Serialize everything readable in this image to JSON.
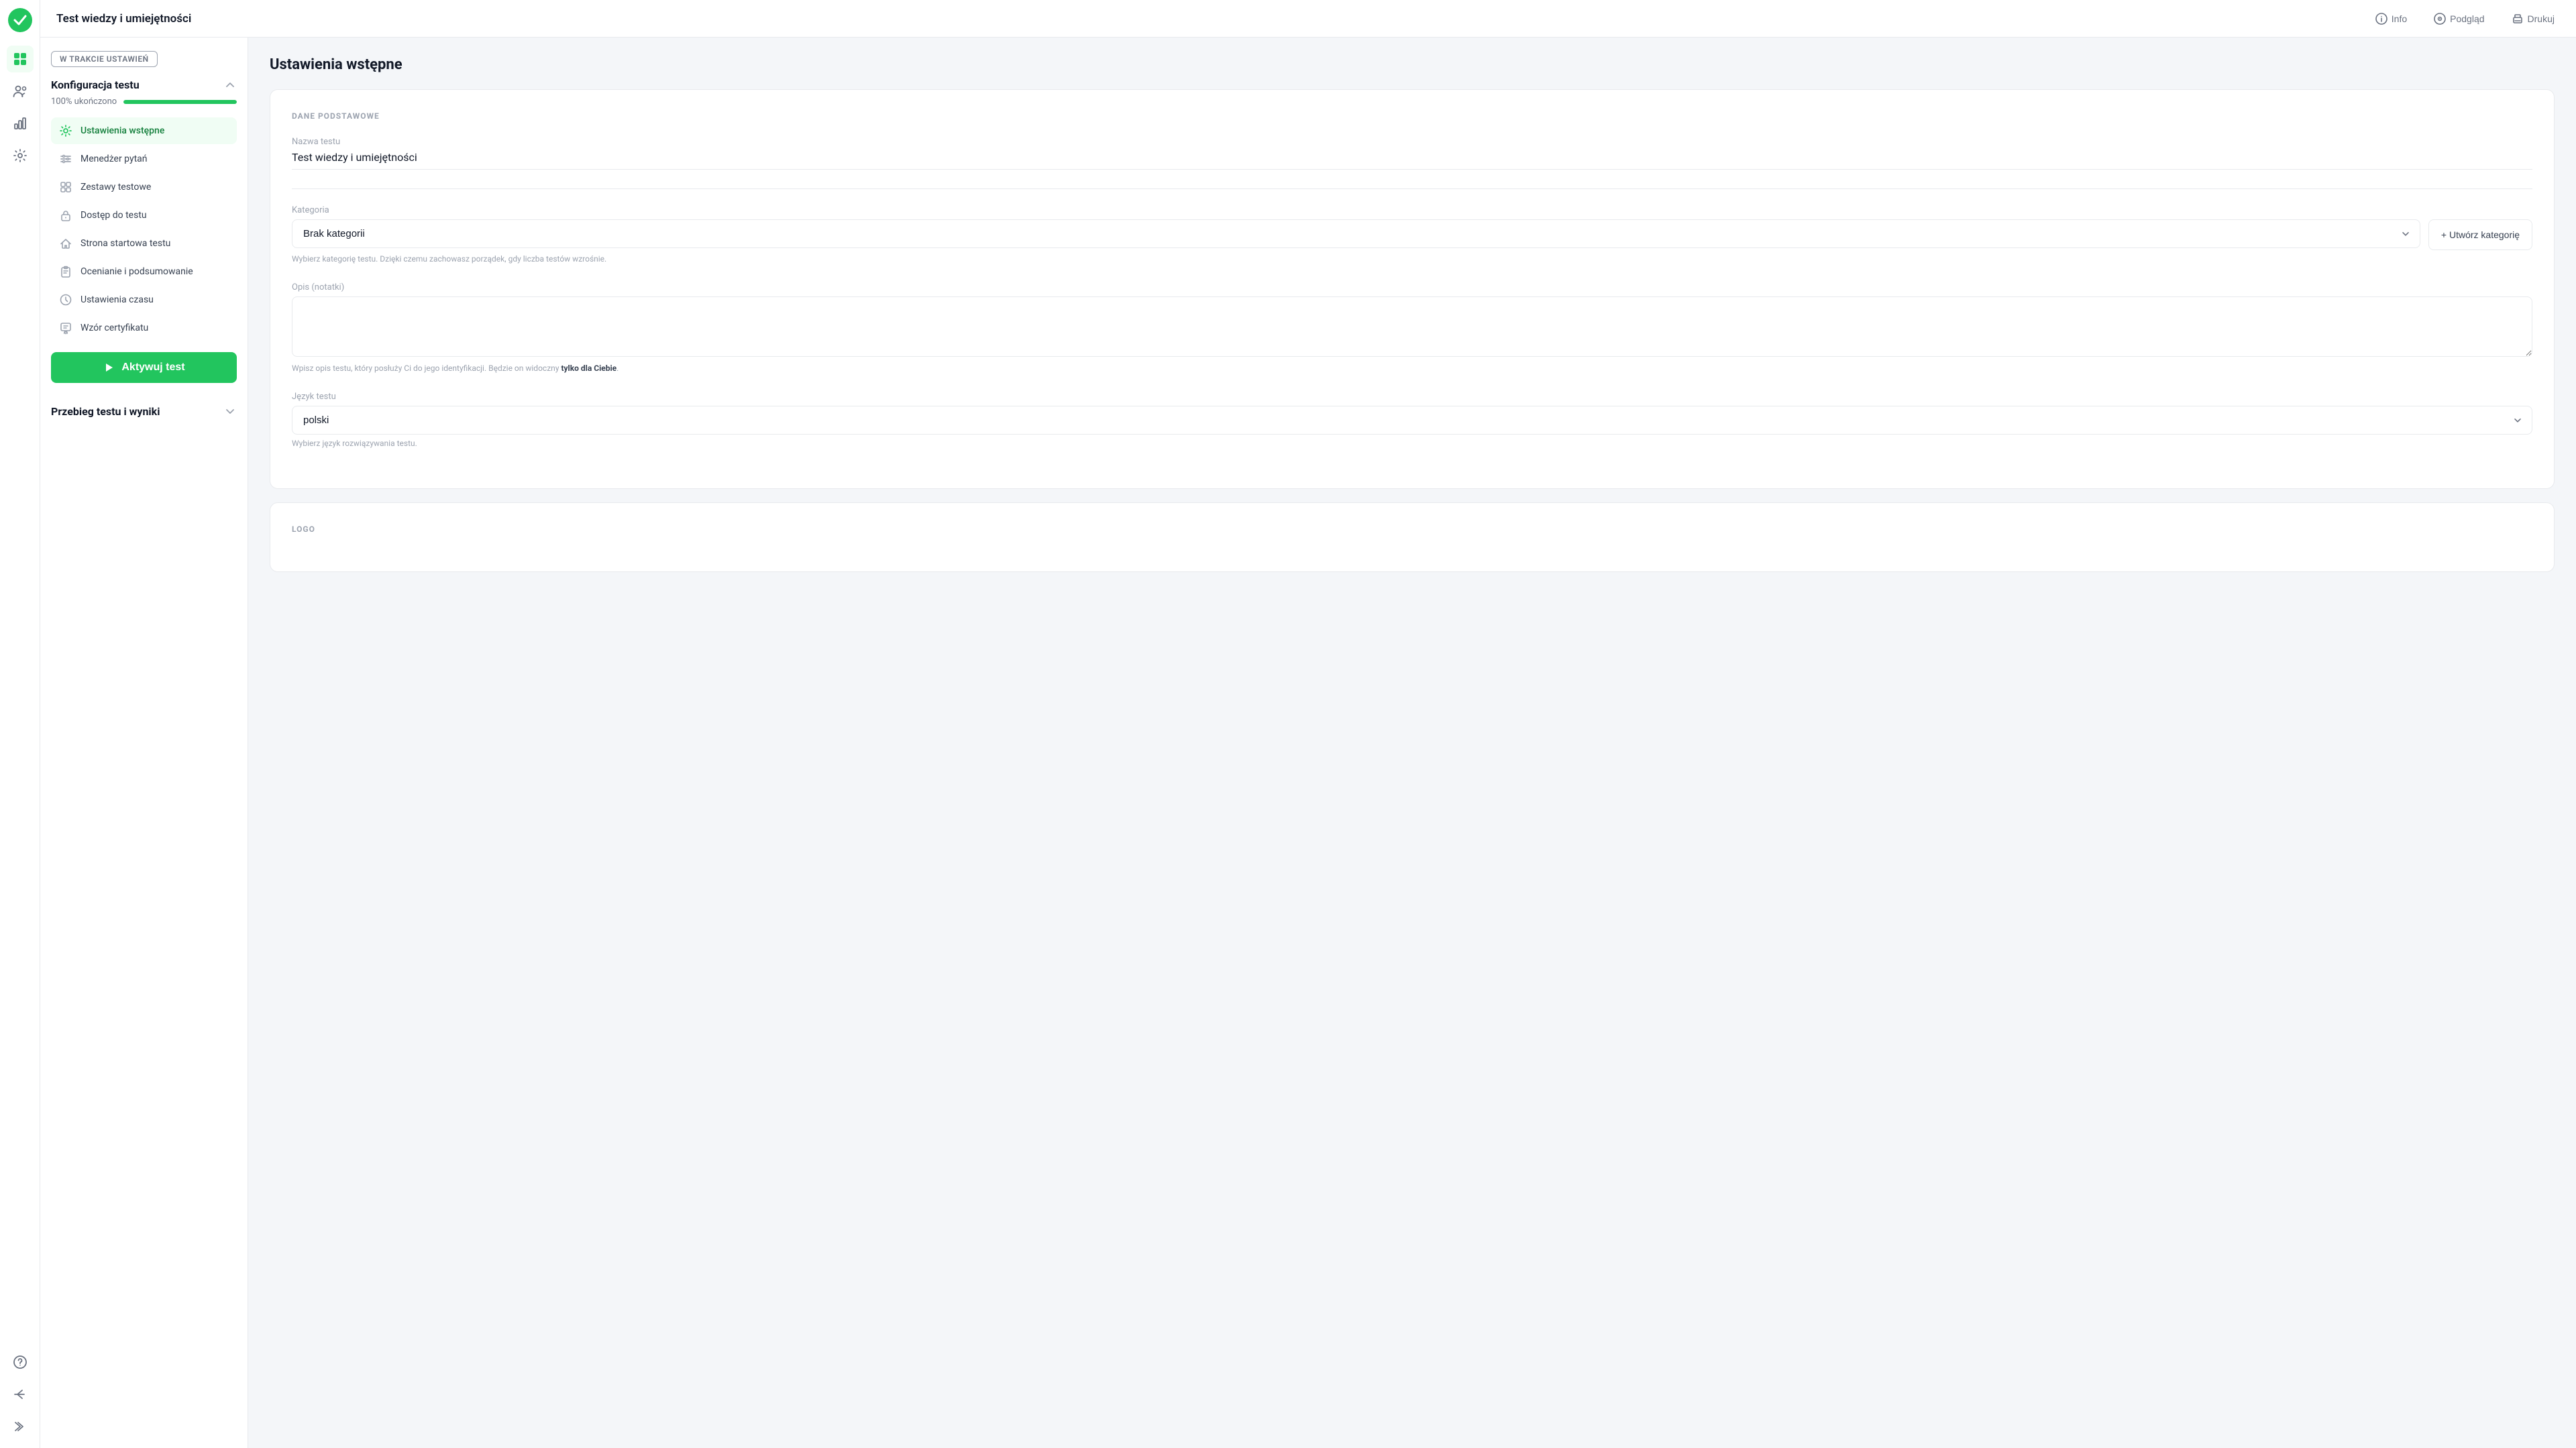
{
  "app": {
    "title": "Test wiedzy i umiejętności"
  },
  "header": {
    "title": "Test wiedzy i umiejętności",
    "actions": [
      {
        "id": "info",
        "label": "Info",
        "icon": "info-icon"
      },
      {
        "id": "preview",
        "label": "Podgląd",
        "icon": "eye-icon"
      },
      {
        "id": "print",
        "label": "Drukuj",
        "icon": "print-icon"
      }
    ]
  },
  "sidebar": {
    "status_badge": "W TRAKCIE USTAWIEŃ",
    "section1_title": "Konfiguracja testu",
    "progress_label": "100% ukończono",
    "progress_pct": 100,
    "nav_items": [
      {
        "id": "ustawienia-wstepne",
        "label": "Ustawienia wstępne",
        "active": true
      },
      {
        "id": "menedzer-pytan",
        "label": "Menedżer pytań",
        "active": false
      },
      {
        "id": "zestawy-testowe",
        "label": "Zestawy testowe",
        "active": false
      },
      {
        "id": "dostep-do-testu",
        "label": "Dostęp do testu",
        "active": false
      },
      {
        "id": "strona-startowa-testu",
        "label": "Strona startowa testu",
        "active": false
      },
      {
        "id": "ocenianie-i-podsumowanie",
        "label": "Ocenianie i podsumowanie",
        "active": false
      },
      {
        "id": "ustawienia-czasu",
        "label": "Ustawienia czasu",
        "active": false
      },
      {
        "id": "wzor-certyfikatu",
        "label": "Wzór certyfikatu",
        "active": false
      }
    ],
    "activate_btn_label": "Aktywuj test",
    "section2_title": "Przebieg testu i wyniki"
  },
  "main": {
    "page_title": "Ustawienia wstępne",
    "section_label": "DANE PODSTAWOWE",
    "fields": {
      "nazwa_label": "Nazwa testu",
      "nazwa_value": "Test wiedzy i umiejętności",
      "kategoria_label": "Kategoria",
      "kategoria_value": "Brak kategorii",
      "kategoria_hint": "Wybierz kategorię testu. Dzięki czemu zachowasz porządek, gdy liczba testów wzrośnie.",
      "create_category_label": "+ Utwórz kategorię",
      "opis_label": "Opis (notatki)",
      "opis_placeholder": "",
      "opis_hint_prefix": "Wpisz opis testu, który posłuży Ci do jego identyfikacji. Będzie on widoczny ",
      "opis_hint_bold": "tylko dla Ciebie",
      "opis_hint_suffix": ".",
      "jezyk_label": "Język testu",
      "jezyk_value": "polski",
      "jezyk_hint": "Wybierz język rozwiązywania testu."
    },
    "section2_label": "LOGO"
  },
  "iconbar": {
    "items": [
      {
        "id": "dashboard",
        "icon": "grid-icon"
      },
      {
        "id": "users",
        "icon": "users-icon"
      },
      {
        "id": "analytics",
        "icon": "analytics-icon"
      },
      {
        "id": "settings",
        "icon": "settings-icon"
      }
    ],
    "bottom_items": [
      {
        "id": "help",
        "icon": "help-icon"
      },
      {
        "id": "back",
        "icon": "back-icon"
      },
      {
        "id": "collapse",
        "icon": "collapse-icon"
      }
    ]
  }
}
